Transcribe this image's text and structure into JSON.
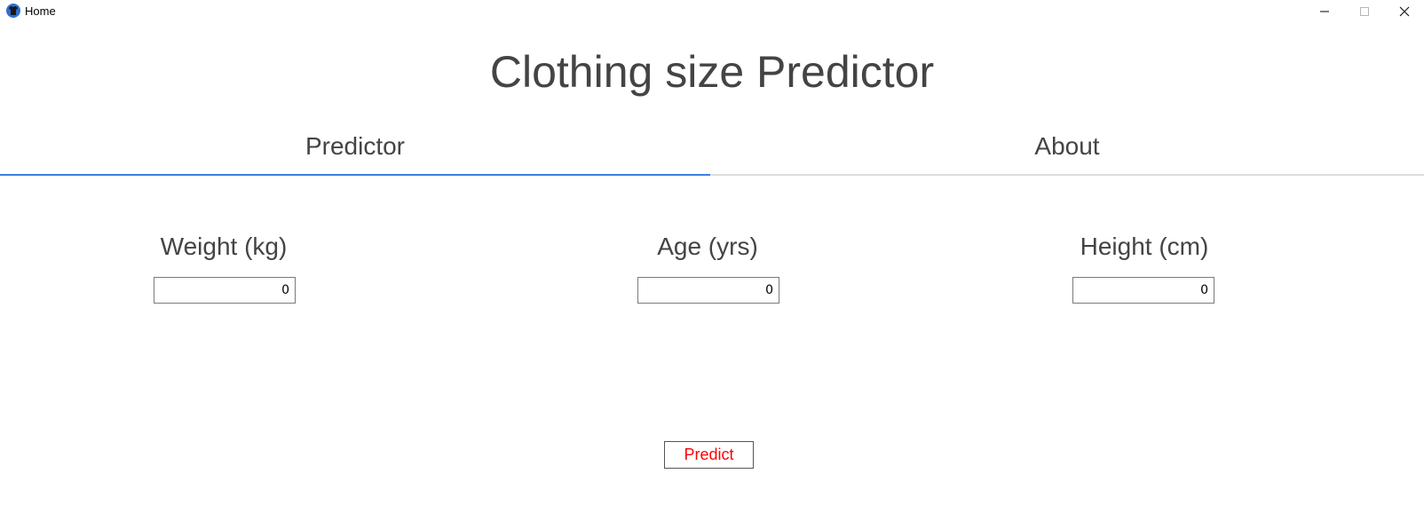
{
  "window": {
    "title": "Home",
    "icon": "shirt-icon",
    "controls": [
      "minimize-icon",
      "maximize-icon",
      "close-icon"
    ]
  },
  "page": {
    "title": "Clothing size Predictor"
  },
  "tabs": [
    {
      "label": "Predictor",
      "active": true
    },
    {
      "label": "About",
      "active": false
    }
  ],
  "fields": {
    "weight": {
      "label": "Weight (kg)",
      "value": "0"
    },
    "age": {
      "label": "Age (yrs)",
      "value": "0"
    },
    "height": {
      "label": "Height (cm)",
      "value": "0"
    }
  },
  "predict_button": {
    "label": "Predict"
  },
  "colors": {
    "tab_indicator": "#3b7fe6",
    "predict_text": "#ff0000",
    "text": "#444444"
  }
}
